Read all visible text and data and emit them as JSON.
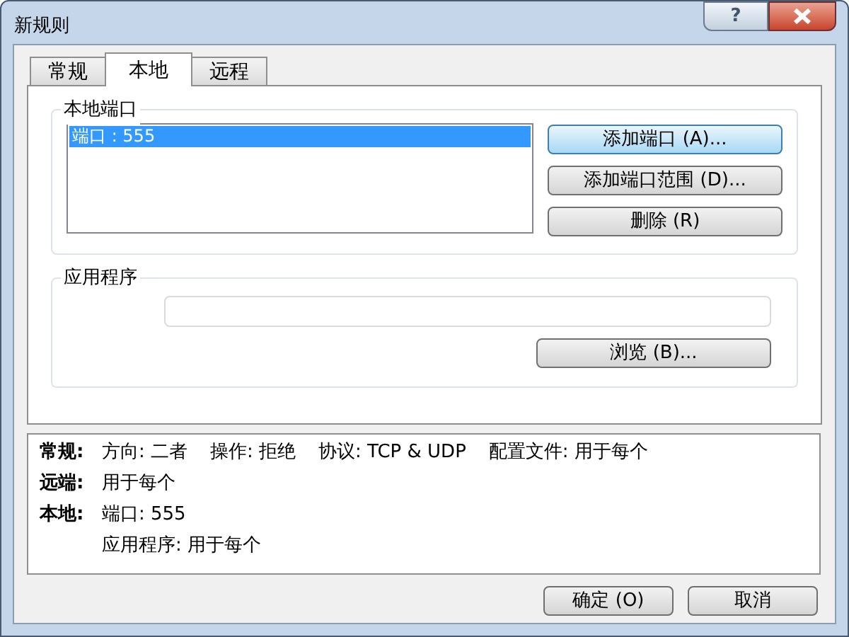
{
  "window": {
    "title": "新规则",
    "help_button": "?"
  },
  "tabs": [
    {
      "label": "常规",
      "selected": false
    },
    {
      "label": "本地",
      "selected": true
    },
    {
      "label": "远程",
      "selected": false
    }
  ],
  "local_ports": {
    "title": "本地端口",
    "items": [
      {
        "label": "端口 : 555",
        "selected": true
      }
    ],
    "buttons": [
      {
        "label": "添加端口 (A)...",
        "default": true
      },
      {
        "label": "添加端口范围 (D)...",
        "default": false
      },
      {
        "label": "删除 (R)",
        "default": false
      }
    ]
  },
  "application": {
    "title": "应用程序",
    "button": "浏览 (B)..."
  },
  "summary": [
    {
      "label": "常规:",
      "items": [
        "方向: 二者",
        "操作: 拒绝",
        "协议: TCP & UDP",
        "配置文件: 用于每个"
      ]
    },
    {
      "label": "远端:",
      "items": [
        "用于每个"
      ]
    },
    {
      "label": "本地:",
      "items": [
        "端口: 555"
      ]
    },
    {
      "items": [
        "应用程序: 用于每个"
      ]
    }
  ],
  "buttons": [
    "确定 (O)",
    "取消"
  ]
}
